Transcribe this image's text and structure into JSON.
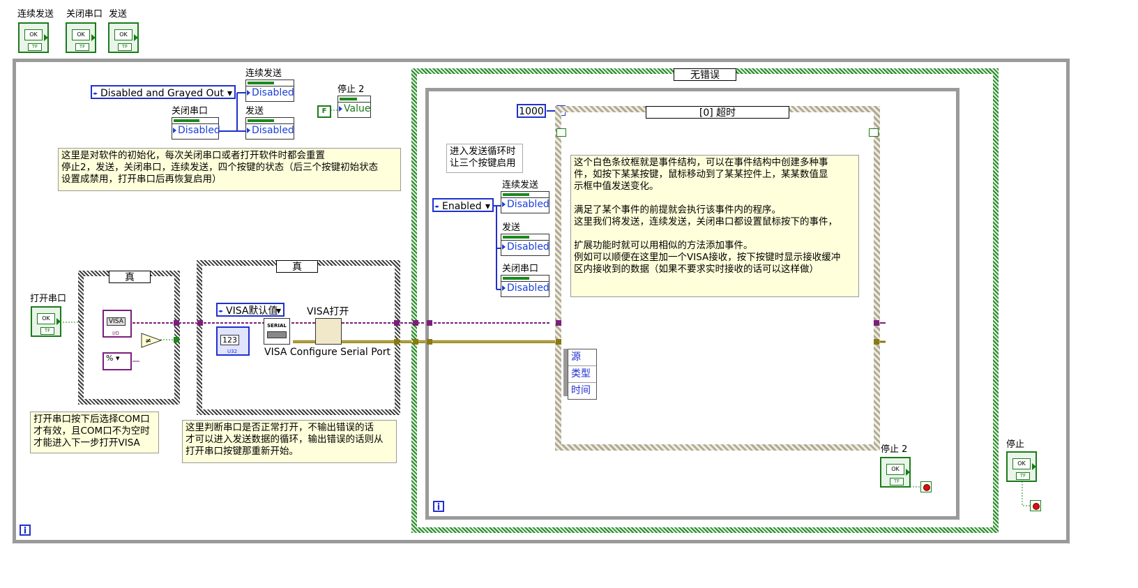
{
  "top_controls": [
    {
      "label": "连续发送",
      "btn": "OK",
      "tf": "TF"
    },
    {
      "label": "关闭串口",
      "btn": "OK",
      "tf": "TF"
    },
    {
      "label": "发送",
      "btn": "OK",
      "tf": "TF"
    }
  ],
  "init": {
    "enum_value": "Disabled and Grayed Out",
    "prop_lianxu": {
      "label": "连续发送",
      "value": "Disabled"
    },
    "prop_guanbi": {
      "label": "关闭串口",
      "value": "Disabled"
    },
    "prop_fasong": {
      "label": "发送",
      "value": "Disabled"
    },
    "stop2_label": "停止 2",
    "false_const": "F",
    "stop2_value": "Value",
    "note": "这里是对软件的初始化，每次关闭串口或者打开软件时都会重置\n停止2，发送，关闭串口，连续发送，四个按键的状态（后三个按键初始状态\n设置成禁用，打开串口后再恢复启用）"
  },
  "open_port": {
    "label": "打开串口",
    "btn": "OK",
    "tf": "TF",
    "case1_selector": "真",
    "visa_const": "VISA",
    "io_label": "I/O",
    "case2_selector": "真",
    "visa_default": "VISA默认值",
    "visa_open": "VISA打开",
    "numeric": "123",
    "numeric_type": "U32",
    "serial_label": "SERIAL",
    "configure_label": "VISA Configure Serial Port",
    "note1": "打开串口按下后选择COM口\n才有效，且COM口不为空时\n才能进入下一步打开VISA",
    "note2": "这里判断串口是否正常打开，不输出错误的话\n才可以进入发送数据的循环，输出错误的话则从\n打开串口按键那重新开始。"
  },
  "error_case": {
    "selector": "无错误",
    "loop_note": "进入发送循环时\n让三个按键启用",
    "enum_value": "Enabled",
    "prop_lianxu": {
      "label": "连续发送",
      "value": "Disabled"
    },
    "prop_fasong": {
      "label": "发送",
      "value": "Disabled"
    },
    "prop_guanbi": {
      "label": "关闭串口",
      "value": "Disabled"
    },
    "timeout": "1000",
    "event_selector": "[0] 超时",
    "event_note": "这个白色条纹框就是事件结构，可以在事件结构中创建多种事\n件，如按下某某按键，鼠标移动到了某某控件上，某某数值显\n示框中值发送变化。\n\n满足了某个事件的前提就会执行该事件内的程序。\n这里我们将发送，连续发送，关闭串口都设置鼠标按下的事件，\n\n扩展功能时就可以用相似的方法添加事件。\n例如可以顺便在这里加一个VISA接收，按下按键时显示接收缓冲\n区内接收到的数据（如果不要求实时接收的话可以这样做）",
    "event_items": [
      "源",
      "类型",
      "时间"
    ],
    "stop2_label": "停止 2"
  },
  "stop": {
    "label": "停止",
    "btn": "OK",
    "tf": "TF"
  },
  "info_icon": "i"
}
